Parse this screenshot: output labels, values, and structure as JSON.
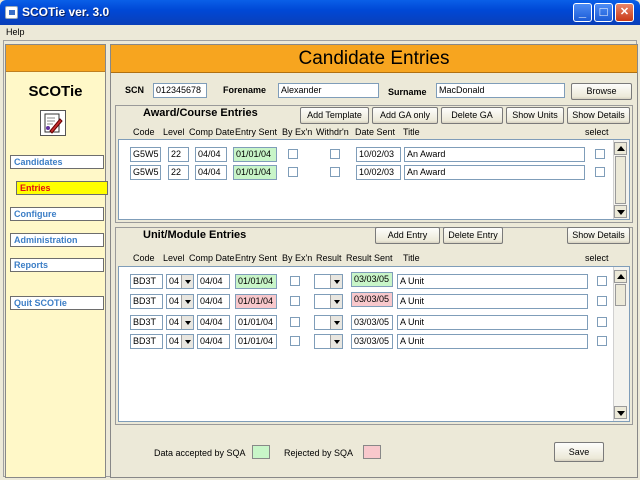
{
  "window": {
    "title": "SCOTie ver. 3.0",
    "min": "_",
    "max": "□",
    "close": "✕"
  },
  "menu": {
    "help": "Help"
  },
  "sidebar": {
    "app_name": "SCOTie",
    "items": [
      {
        "label": "Candidates"
      },
      {
        "label": "Entries",
        "active": true
      },
      {
        "label": "Configure"
      },
      {
        "label": "Administration"
      },
      {
        "label": "Reports"
      },
      {
        "label": "Quit SCOTie"
      }
    ]
  },
  "header": {
    "title": "Candidate Entries"
  },
  "candidate": {
    "scn_label": "SCN",
    "scn": "012345678",
    "forename_label": "Forename",
    "forename": "Alexander",
    "surname_label": "Surname",
    "surname": "MacDonald",
    "browse": "Browse"
  },
  "award": {
    "title": "Award/Course Entries",
    "buttons": [
      "Add Template",
      "Add GA only",
      "Delete GA",
      "Show Units",
      "Show Details"
    ],
    "columns": {
      "code": "Code",
      "level": "Level",
      "comp_date": "Comp Date",
      "entry_sent": "Entry Sent",
      "by_exn": "By Ex'n",
      "withdrn": "Withdr'n",
      "date_sent": "Date Sent",
      "title": "Title",
      "select": "select"
    },
    "rows": [
      {
        "code": "G5W5",
        "level": "22",
        "comp_date": "04/04",
        "entry_sent": "01/01/04",
        "date_sent": "10/02/03",
        "title": "An Award"
      },
      {
        "code": "G5W5",
        "level": "22",
        "comp_date": "04/04",
        "entry_sent": "01/01/04",
        "date_sent": "10/02/03",
        "title": "An Award"
      }
    ]
  },
  "units": {
    "title": "Unit/Module Entries",
    "add_entry": "Add Entry",
    "delete_entry": "Delete Entry",
    "show_details": "Show Details",
    "columns": {
      "code": "Code",
      "level": "Level",
      "comp_date": "Comp Date",
      "entry_sent": "Entry Sent",
      "by_exn": "By Ex'n",
      "result": "Result",
      "result_sent": "Result Sent",
      "title": "Title",
      "select": "select"
    },
    "rows": [
      {
        "code": "BD3T",
        "level": "04",
        "comp_date": "04/04",
        "entry_sent": "01/01/04",
        "entry_status": "green",
        "result_sent": "03/03/05",
        "result_status": "green",
        "title": "A Unit"
      },
      {
        "code": "BD3T",
        "level": "04",
        "comp_date": "04/04",
        "entry_sent": "01/01/04",
        "entry_status": "pink",
        "result_sent": "03/03/05",
        "result_status": "pink",
        "title": "A Unit"
      },
      {
        "code": "BD3T",
        "level": "04",
        "comp_date": "04/04",
        "entry_sent": "01/01/04",
        "entry_status": "none",
        "result_sent": "03/03/05",
        "result_status": "none",
        "title": "A Unit"
      },
      {
        "code": "BD3T",
        "level": "04",
        "comp_date": "04/04",
        "entry_sent": "01/01/04",
        "entry_status": "none",
        "result_sent": "03/03/05",
        "result_status": "none",
        "title": "A Unit"
      }
    ]
  },
  "legend": {
    "accepted": "Data accepted by SQA",
    "rejected": "Rejected by SQA",
    "accepted_color": "#c8f5c8",
    "rejected_color": "#f8c8cc"
  },
  "save": "Save"
}
